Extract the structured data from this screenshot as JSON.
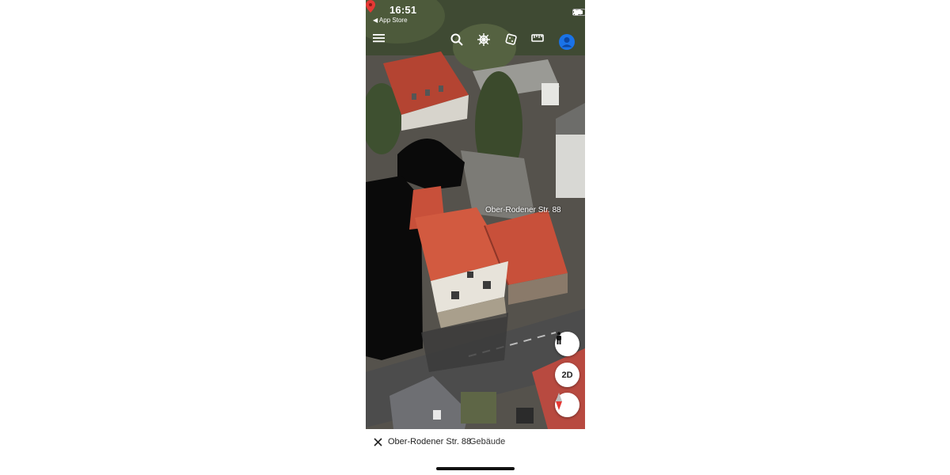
{
  "status_bar": {
    "time": "16:51",
    "back_label": "◀ App Store"
  },
  "toolbar": {
    "menu_icon": "hamburger-icon",
    "search_icon": "search-icon",
    "voyager_icon": "ship-wheel-icon",
    "dice_icon": "dice-icon",
    "measure_icon": "ruler-icon",
    "account_icon": "account-icon"
  },
  "map": {
    "address_label": "Ober-Rodener Str. 88",
    "pin_color": "#e53935"
  },
  "controls": {
    "pegman_icon": "pegman-icon",
    "view_mode": "2D",
    "compass_icon": "compass-icon"
  },
  "bottom_bar": {
    "address": "Ober-Rodener Str. 88",
    "type": "Gebäude"
  },
  "colors": {
    "accent": "#1a73e8",
    "roof": "#c8503a"
  }
}
